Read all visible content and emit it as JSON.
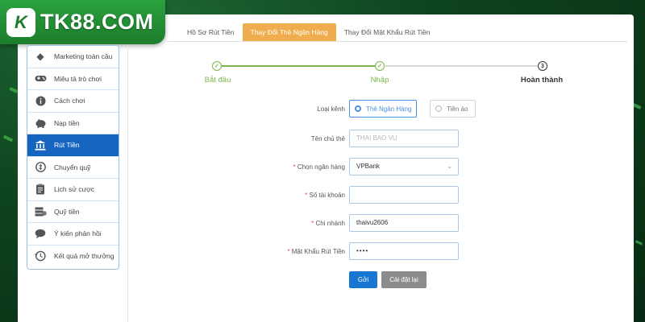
{
  "brand": {
    "logo_mark": "K",
    "name": "TK88.COM"
  },
  "sidebar": {
    "items": [
      {
        "label": "Marketing toàn cầu",
        "icon": "diamond-icon"
      },
      {
        "label": "Miêu tả trò chơi",
        "icon": "gamepad-icon"
      },
      {
        "label": "Cách chơi",
        "icon": "info-icon"
      },
      {
        "label": "Nạp tiền",
        "icon": "piggy-bank-icon"
      },
      {
        "label": "Rút Tiền",
        "icon": "bank-icon",
        "active": true
      },
      {
        "label": "Chuyển quỹ",
        "icon": "transfer-icon"
      },
      {
        "label": "Lịch sử cược",
        "icon": "clipboard-icon"
      },
      {
        "label": "Quỹ tiền",
        "icon": "cash-stack-icon"
      },
      {
        "label": "Ý kiến phản hồi",
        "icon": "chat-icon"
      },
      {
        "label": "Kết quả mở thưởng",
        "icon": "history-icon"
      }
    ]
  },
  "tabs": [
    {
      "label": "Hồ Sơ Rút Tiền"
    },
    {
      "label": "Thay Đổi Thẻ Ngân Hàng",
      "active": true
    },
    {
      "label": "Thay Đổi Mật Khẩu Rút Tiền"
    }
  ],
  "steps": [
    {
      "label": "Bắt đầu",
      "status": "done",
      "mark": "✓"
    },
    {
      "label": "Nhập",
      "status": "done",
      "mark": "✓"
    },
    {
      "label": "Hoàn thành",
      "status": "current",
      "mark": "3"
    }
  ],
  "form": {
    "channel": {
      "label": "Loại kênh",
      "options": [
        {
          "label": "Thẻ Ngân Hàng",
          "selected": true
        },
        {
          "label": "Tiền ảo",
          "selected": false
        }
      ]
    },
    "holder": {
      "label": "Tên chủ thẻ",
      "placeholder": "THAI BAO VU"
    },
    "bank": {
      "required": "*",
      "label": "Chọn ngân hàng",
      "value": "VPBank"
    },
    "account": {
      "required": "*",
      "label": "Số tài khoản",
      "value": ""
    },
    "branch": {
      "required": "*",
      "label": "Chi nhánh",
      "value": "thaivu2606"
    },
    "password": {
      "required": "*",
      "label": "Mật Khẩu Rút Tiền",
      "value": "••••"
    },
    "submit_label": "Gởi",
    "reset_label": "Cài đặt lại"
  },
  "colors": {
    "accent": "#1565c0",
    "tab_active": "#f0ad4e",
    "step_done": "#7ab648",
    "submit": "#1976d2",
    "reset": "#8c8c8c"
  }
}
